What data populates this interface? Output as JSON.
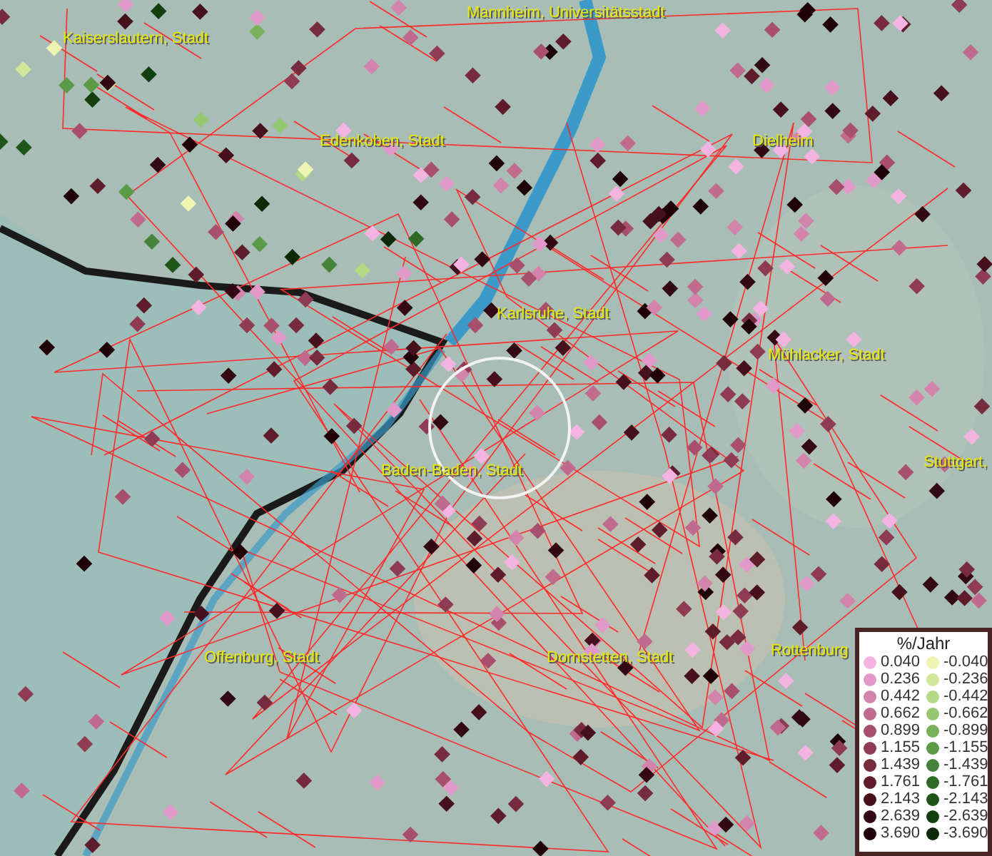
{
  "map": {
    "places": [
      {
        "label": "Mannheim, Universitätsstadt"
      },
      {
        "label": "Kaiserslautern, Stadt"
      },
      {
        "label": "Edenkoben, Stadt"
      },
      {
        "label": "Dielheim"
      },
      {
        "label": "Karlsruhe, Stadt"
      },
      {
        "label": "Mühlacker, Stadt"
      },
      {
        "label": "Stuttgart,"
      },
      {
        "label": "Baden-Baden, Stadt"
      },
      {
        "label": "Offenburg, Stadt"
      },
      {
        "label": "Dornstetten, Stadt"
      },
      {
        "label": "Rottenburg"
      }
    ]
  },
  "legend": {
    "title": "%/Jahr",
    "entries": [
      {
        "label": "0.040",
        "color": "#f4b4e2"
      },
      {
        "label": "-0.040",
        "color": "#eef5b2"
      },
      {
        "label": "0.236",
        "color": "#e199c9"
      },
      {
        "label": "-0.236",
        "color": "#d0e79c"
      },
      {
        "label": "0.442",
        "color": "#d384ad"
      },
      {
        "label": "-0.442",
        "color": "#b3d886"
      },
      {
        "label": "0.662",
        "color": "#c06a8e"
      },
      {
        "label": "-0.662",
        "color": "#95c672"
      },
      {
        "label": "0.899",
        "color": "#a84f6d"
      },
      {
        "label": "-0.899",
        "color": "#78b05c"
      },
      {
        "label": "1.155",
        "color": "#8f3b53"
      },
      {
        "label": "-1.155",
        "color": "#5b9a47"
      },
      {
        "label": "1.439",
        "color": "#762b3e"
      },
      {
        "label": "-1.439",
        "color": "#46833a"
      },
      {
        "label": "1.761",
        "color": "#5f1c2a"
      },
      {
        "label": "-1.761",
        "color": "#2f6a26"
      },
      {
        "label": "2.143",
        "color": "#46111c"
      },
      {
        "label": "-2.143",
        "color": "#1f5519"
      },
      {
        "label": "2.639",
        "color": "#330a13"
      },
      {
        "label": "-2.639",
        "color": "#133f0f"
      },
      {
        "label": "3.690",
        "color": "#200308"
      },
      {
        "label": "-3.690",
        "color": "#0a2a08"
      }
    ]
  }
}
